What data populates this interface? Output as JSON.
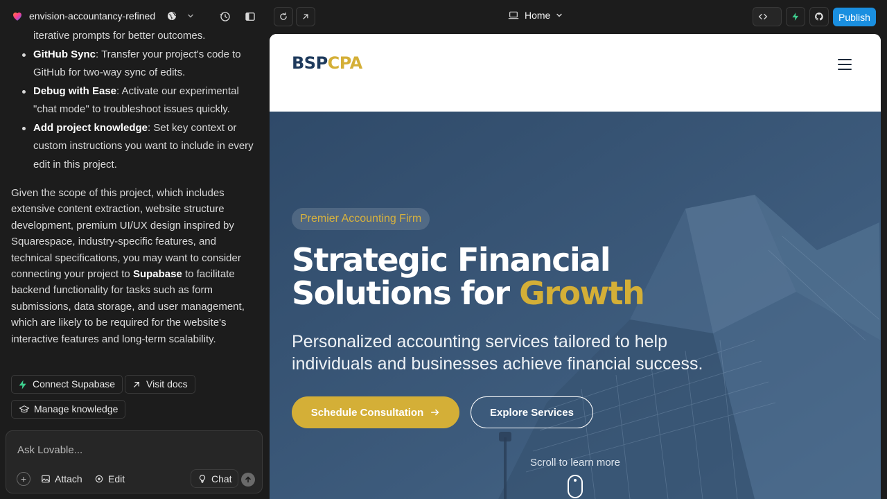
{
  "topbar": {
    "project_name": "envision-accountancy-refined",
    "route_label": "Home",
    "publish_label": "Publish"
  },
  "chat": {
    "items": [
      {
        "bold": "",
        "text": "iterative prompts for better outcomes."
      },
      {
        "bold": "GitHub Sync",
        "text": ": Transfer your project's code to GitHub for two-way sync of edits."
      },
      {
        "bold": "Debug with Ease",
        "text": ": Activate our experimental \"chat mode\" to troubleshoot issues quickly."
      },
      {
        "bold": "Add project knowledge",
        "text": ": Set key context or custom instructions you want to include in every edit in this project."
      }
    ],
    "paragraph_before": "Given the scope of this project, which includes extensive content extraction, website structure development, premium UI/UX design inspired by Squarespace, industry-specific features, and technical specifications, you may want to consider connecting your project to ",
    "paragraph_bold": "Supabase",
    "paragraph_after": " to facilitate backend functionality for tasks such as form submissions, data storage, and user management, which are likely to be required for the website's interactive features and long-term scalability.",
    "chips": {
      "connect_supabase": "Connect Supabase",
      "visit_docs": "Visit docs",
      "manage_knowledge": "Manage knowledge"
    },
    "composer": {
      "placeholder": "Ask Lovable...",
      "attach": "Attach",
      "edit": "Edit",
      "chat": "Chat"
    }
  },
  "preview": {
    "logo_part1": "BSP",
    "logo_part2": "CPA",
    "badge": "Premier Accounting Firm",
    "headline_line1": "Strategic Financial",
    "headline_line2": "Solutions for ",
    "headline_highlight": "Growth",
    "subheadline": "Personalized accounting services tailored to help individuals and businesses achieve financial success.",
    "cta_primary": "Schedule Consultation",
    "cta_secondary": "Explore Services",
    "scroll_hint": "Scroll to learn more"
  },
  "colors": {
    "brand_navy": "#1e3a5c",
    "brand_gold": "#d4af37",
    "publish_blue": "#1a8fe0",
    "supabase_green": "#3ecf8e"
  }
}
